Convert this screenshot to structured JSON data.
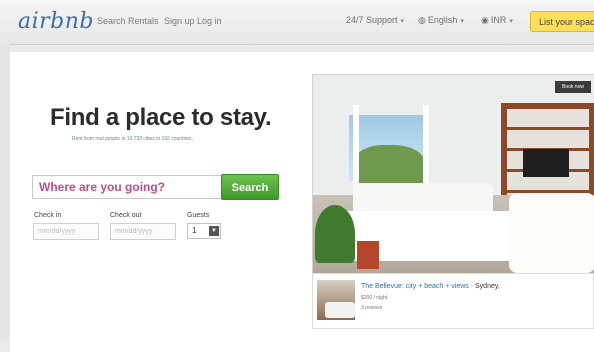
{
  "header": {
    "logo": "airbnb",
    "nav": [
      "Search Rentals",
      "Sign up",
      "Log in"
    ],
    "support": "24/7 Support",
    "language": "English",
    "currency": "INR",
    "list_button": "List your space"
  },
  "hero": {
    "headline": "Find a place to stay.",
    "tagline": "Rent from real people in 19,733 cities in 192 countries."
  },
  "search": {
    "placeholder": "Where are you going?",
    "button": "Search",
    "checkin_label": "Check in",
    "checkin_placeholder": "mm/dd/yyyy",
    "checkout_label": "Check out",
    "checkout_placeholder": "mm/dd/yyyy",
    "guests_label": "Guests",
    "guests_value": "1"
  },
  "featured": {
    "photo_tag": "Book now",
    "title": "The Bellevue: city + beach + views",
    "location": "· Sydney,",
    "price": "$200 / night",
    "reviews": "3 reviews"
  }
}
